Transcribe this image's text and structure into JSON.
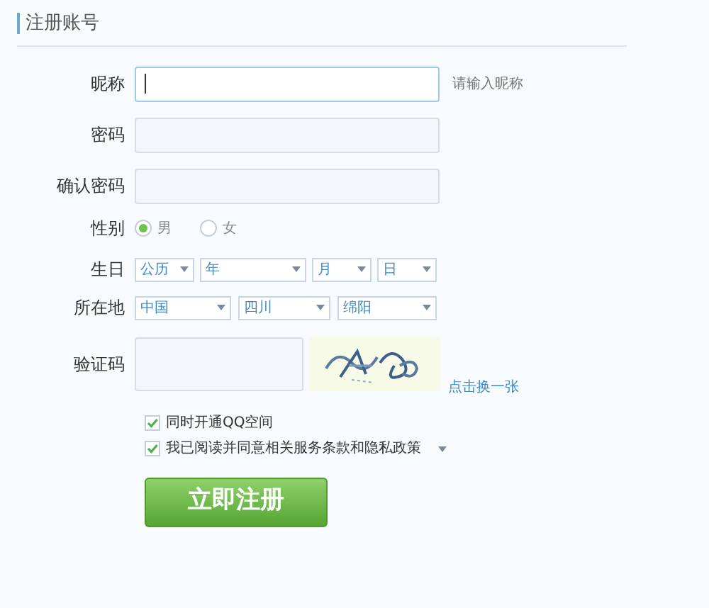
{
  "title": "注册账号",
  "nickname": {
    "label": "昵称",
    "focused": true,
    "hint": "请输入昵称"
  },
  "password": {
    "label": "密码",
    "focused": false
  },
  "confirm_password": {
    "label": "确认密码",
    "focused": false
  },
  "gender": {
    "label": "性别",
    "options": [
      {
        "label": "男",
        "selected": true
      },
      {
        "label": "女",
        "selected": false
      }
    ]
  },
  "birthday": {
    "label": "生日",
    "selects": [
      {
        "value": "公历"
      },
      {
        "value": "年"
      },
      {
        "value": "月"
      },
      {
        "value": "日"
      }
    ]
  },
  "location": {
    "label": "所在地",
    "selects": [
      {
        "value": "中国"
      },
      {
        "value": "四川"
      },
      {
        "value": "绵阳"
      }
    ]
  },
  "captcha": {
    "label": "验证码",
    "refresh_link": "点击换一张"
  },
  "checkboxes": [
    {
      "label": "同时开通QQ空间",
      "checked": true,
      "has_menu": false
    },
    {
      "label": "我已阅读并同意相关服务条款和隐私政策",
      "checked": true,
      "has_menu": true
    }
  ],
  "submit": "立即注册"
}
